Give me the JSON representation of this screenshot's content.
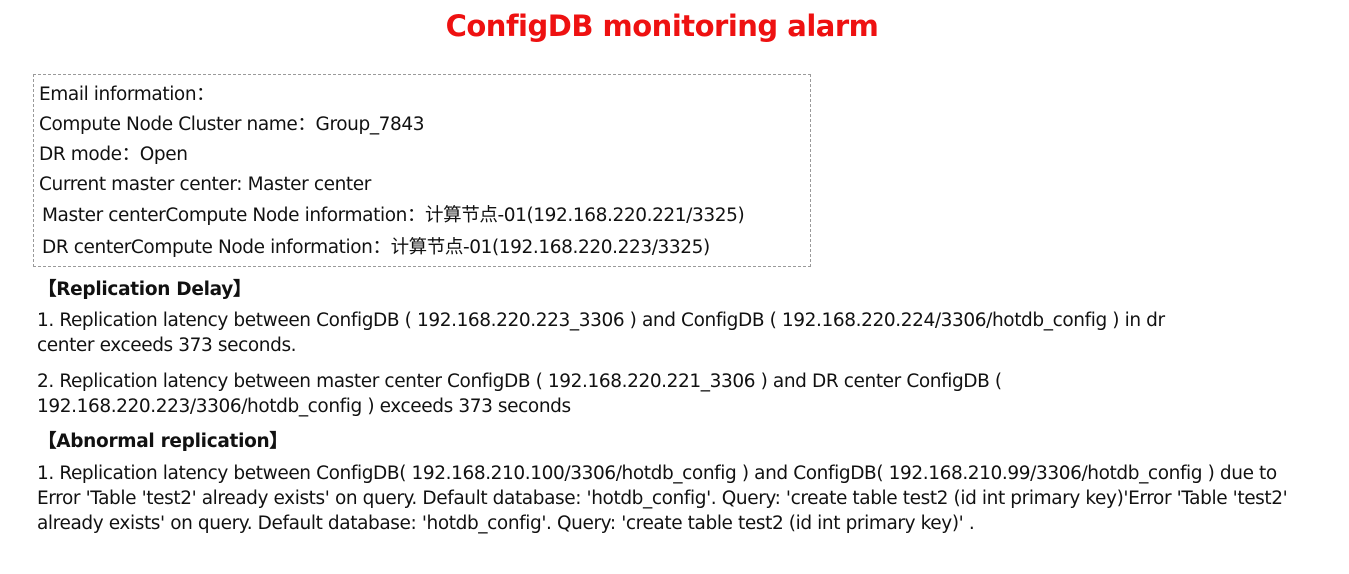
{
  "title": "ConfigDB monitoring alarm",
  "colors": {
    "title": "#ee1111",
    "text": "#111111",
    "box_border": "#9a9a9a"
  },
  "email_info": {
    "heading": "Email information：",
    "cluster_name": "Compute Node Cluster name：Group_7843",
    "dr_mode": "DR mode：Open",
    "current_master": "Current master center: Master center",
    "master_compute_node": "Master centerCompute Node information：计算节点-01(192.168.220.221/3325)",
    "dr_compute_node": "DR centerCompute Node information：计算节点-01(192.168.220.223/3325)"
  },
  "replication_delay": {
    "heading": "【Replication Delay】",
    "items": [
      "1. Replication latency between ConfigDB ( 192.168.220.223_3306 ) and ConfigDB ( 192.168.220.224/3306/hotdb_config ) in dr center exceeds 373 seconds.",
      "2. Replication latency between master center ConfigDB ( 192.168.220.221_3306 ) and DR center ConfigDB ( 192.168.220.223/3306/hotdb_config ) exceeds 373 seconds"
    ]
  },
  "abnormal_replication": {
    "heading": "【Abnormal replication】",
    "items": [
      "1. Replication latency between ConfigDB( 192.168.210.100/3306/hotdb_config ) and ConfigDB( 192.168.210.99/3306/hotdb_config ) due to  Error 'Table 'test2' already exists' on query. Default database: 'hotdb_config'. Query: 'create table test2 (id int primary key)'Error 'Table 'test2' already exists' on query. Default database: 'hotdb_config'. Query: 'create table test2 (id int primary key)' ."
    ]
  }
}
